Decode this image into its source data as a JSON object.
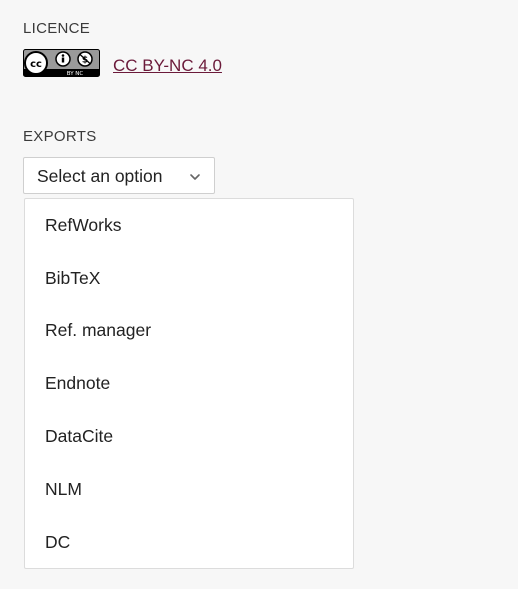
{
  "licence": {
    "section_label": "LICENCE",
    "badge_icon": "cc-by-nc-icon",
    "badge_text": "BY NC",
    "link_text": "CC BY-NC 4.0",
    "link_color": "#6b1a3a"
  },
  "exports": {
    "section_label": "EXPORTS",
    "select": {
      "placeholder": "Select an option",
      "icon": "chevron-down-icon"
    },
    "options": [
      "RefWorks",
      "BibTeX",
      "Ref. manager",
      "Endnote",
      "DataCite",
      "NLM",
      "DC"
    ]
  }
}
